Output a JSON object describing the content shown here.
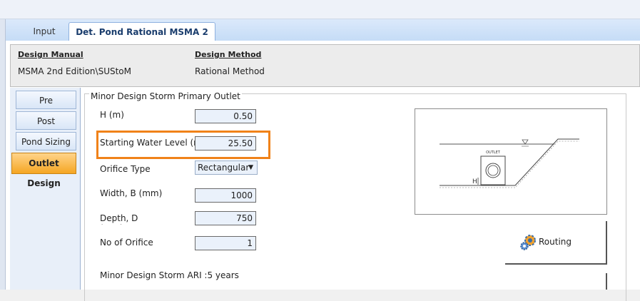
{
  "tabs": {
    "input": "Input",
    "det_pond": "Det. Pond Rational MSMA 2"
  },
  "info": {
    "design_manual_label": "Design Manual",
    "design_manual_value": "MSMA 2nd Edition\\SUStoM",
    "design_method_label": "Design Method",
    "design_method_value": "Rational Method"
  },
  "side_tabs": [
    "Pre",
    "Post",
    "Pond Sizing",
    "Outlet Design"
  ],
  "group": {
    "title": "Minor Design Storm Primary Outlet",
    "h_label": "H (m)",
    "h_value": "0.50",
    "swl_label": "Starting Water Level (m)",
    "swl_value": "25.50",
    "orifice_type_label": "Orifice Type",
    "orifice_type_value": "Rectangular",
    "width_label": "Width, B (mm)",
    "width_value": "1000",
    "depth_label": "Depth, D (mm)",
    "depth_value": "750",
    "no_orifice_label": "No of Orifice",
    "no_orifice_value": "1",
    "ari_label": "Minor Design Storm ARI :5 years"
  },
  "diagram": {
    "outlet_text": "OUTLET",
    "h_text": "H"
  },
  "routing_label": "Routing",
  "colors": {
    "highlight": "#f08219",
    "active_tab": "#f5a623",
    "input_bg": "#eaf1fb"
  }
}
